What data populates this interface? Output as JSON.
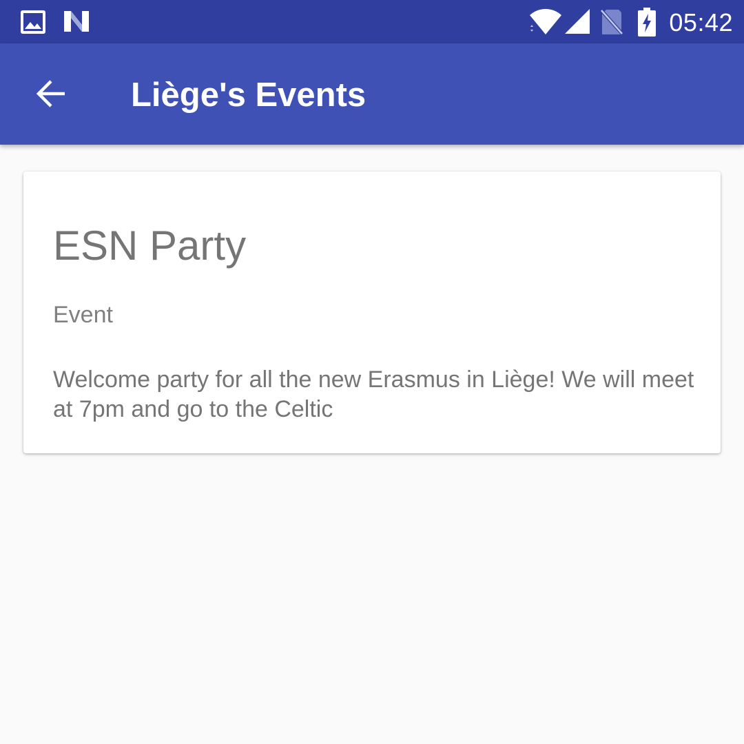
{
  "status_bar": {
    "time": "05:42",
    "icons": [
      "image-notification-icon",
      "n-notification-icon",
      "wifi-icon",
      "cell-signal-icon",
      "no-sim-icon",
      "battery-charging-icon"
    ]
  },
  "app_bar": {
    "title": "Liège's Events",
    "back_icon": "arrow-back-icon"
  },
  "event": {
    "title": "ESN Party",
    "type": "Event",
    "description": "Welcome party for all the new Erasmus in Liège! We will meet at 7pm and go to the Celtic"
  },
  "colors": {
    "status_bar": "#303f9f",
    "app_bar": "#3f51b5",
    "background": "#fafafa",
    "card": "#ffffff",
    "text_secondary": "#757575"
  }
}
